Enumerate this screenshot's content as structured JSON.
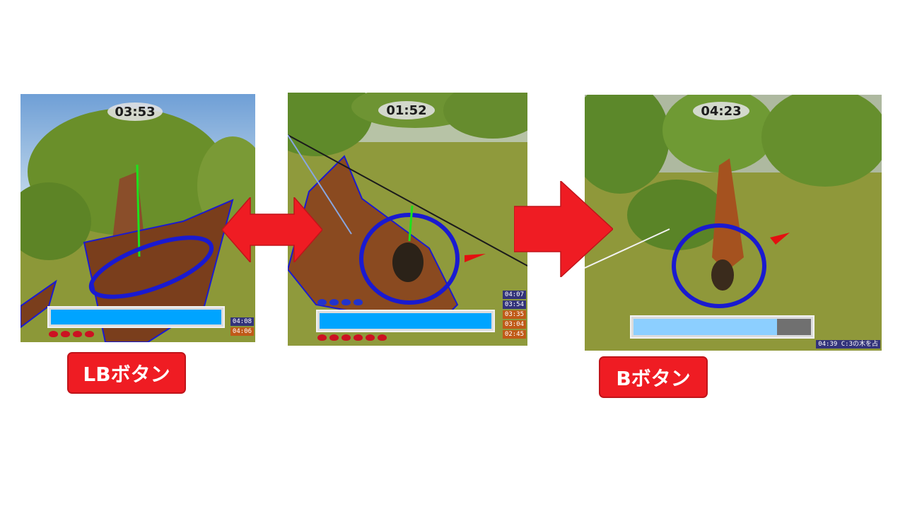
{
  "colors": {
    "ring": "#1a1ad0",
    "bar_fill": "#00a4ff",
    "bar_fill_light": "#8ccfff",
    "bar_empty": "#707070",
    "button_red": "#ef1c23",
    "log_blue": "#33337a",
    "log_orange": "#c05a18",
    "enemy_red": "#cc1122",
    "friend_blue": "#2233cc"
  },
  "panels": [
    {
      "timer": "03:53",
      "gauge_fill": 1.0,
      "log": [
        {
          "text": "04:08",
          "team": "blue"
        },
        {
          "text": "04:06",
          "team": "orange"
        }
      ],
      "red_marks": 4,
      "blue_marks": 0
    },
    {
      "timer": "01:52",
      "gauge_fill": 1.0,
      "log": [
        {
          "text": "04:07",
          "team": "blue"
        },
        {
          "text": "03:54",
          "team": "blue"
        },
        {
          "text": "03:35",
          "team": "orange"
        },
        {
          "text": "03:04",
          "team": "orange"
        },
        {
          "text": "02:45",
          "team": "orange"
        }
      ],
      "red_marks": 6,
      "blue_marks": 4
    },
    {
      "timer": "04:23",
      "gauge_fill": 0.81,
      "log": [
        {
          "text": "04:39 C:3の木を占",
          "team": "blue"
        }
      ],
      "red_marks": 0,
      "blue_marks": 0
    }
  ],
  "icons": {
    "double_arrow": "double-headed-arrow-icon",
    "right_arrow": "right-arrow-icon"
  },
  "buttons": {
    "lb": "LBボタン",
    "b": "Bボタン"
  }
}
